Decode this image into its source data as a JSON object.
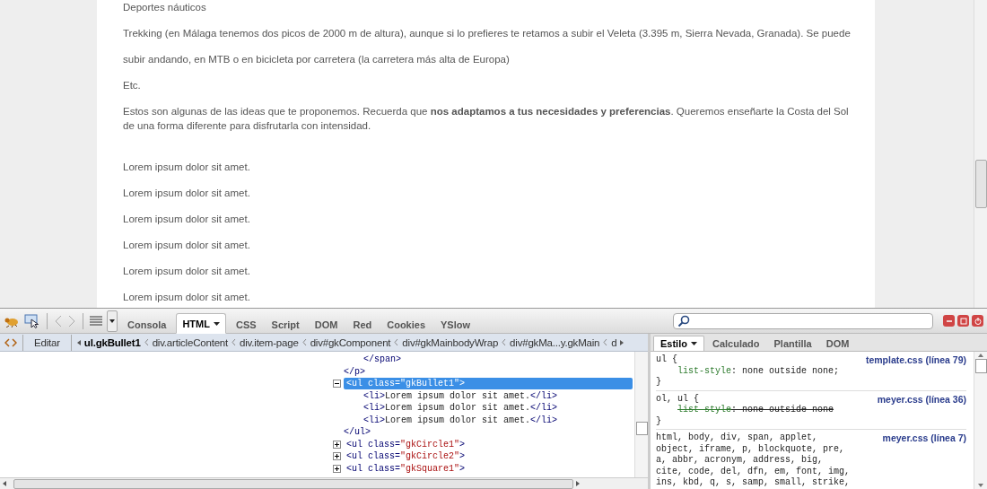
{
  "page": {
    "paragraphs": [
      {
        "kind": "p",
        "text": "Deportes náuticos"
      },
      {
        "kind": "p",
        "text": "Trekking (en Málaga tenemos dos picos de 2000 m de altura), aunque si lo prefieres te retamos a subir el Veleta (3.395 m, Sierra Nevada, Granada). Se puede"
      },
      {
        "kind": "p",
        "text": "subir andando, en MTB o en bicicleta por carretera (la carretera más alta de Europa)"
      },
      {
        "kind": "p",
        "text": "Etc."
      },
      {
        "kind": "p",
        "text": "Estos son algunas de las ideas que te proponemos. Recuerda que **nos adaptamos a tus necesidades y preferencias**. Queremos enseñarte la Costa del Sol de una forma diferente para disfrutarla con intensidad."
      },
      {
        "kind": "li",
        "text": "Lorem ipsum dolor sit amet."
      },
      {
        "kind": "li",
        "text": "Lorem ipsum dolor sit amet."
      },
      {
        "kind": "li",
        "text": "Lorem ipsum dolor sit amet."
      },
      {
        "kind": "li",
        "text": "Lorem ipsum dolor sit amet."
      },
      {
        "kind": "li",
        "text": "Lorem ipsum dolor sit amet."
      },
      {
        "kind": "li",
        "text": "Lorem ipsum dolor sit amet."
      }
    ]
  },
  "devtools": {
    "tabs": [
      {
        "label": "Consola",
        "selected": false,
        "dropdown": false
      },
      {
        "label": "HTML",
        "selected": true,
        "dropdown": true
      },
      {
        "label": "CSS",
        "selected": false,
        "dropdown": false
      },
      {
        "label": "Script",
        "selected": false,
        "dropdown": false
      },
      {
        "label": "DOM",
        "selected": false,
        "dropdown": false
      },
      {
        "label": "Red",
        "selected": false,
        "dropdown": false
      },
      {
        "label": "Cookies",
        "selected": false,
        "dropdown": false
      },
      {
        "label": "YSlow",
        "selected": false,
        "dropdown": false
      }
    ],
    "edit_button": "Editar",
    "breadcrumb": [
      {
        "label": "ul.gkBullet1",
        "selected": true
      },
      {
        "label": "div.articleContent",
        "selected": false
      },
      {
        "label": "div.item-page",
        "selected": false
      },
      {
        "label": "div#gkComponent",
        "selected": false
      },
      {
        "label": "div#gkMainbodyWrap",
        "selected": false
      },
      {
        "label": "div#gkMa...y.gkMain",
        "selected": false
      },
      {
        "label": "d",
        "selected": false
      }
    ],
    "html_tree": [
      {
        "kind": "partial",
        "children": [
          {
            "kind": "close",
            "text": "</span>"
          }
        ],
        "close": "</p>"
      },
      {
        "kind": "element",
        "tag_open": "<ul",
        "attr": " class=",
        "value": "\"gkBullet1\"",
        "tag_end": ">",
        "expanded": true,
        "selected": true,
        "children": [
          {
            "kind": "leaf",
            "open": "<li>",
            "text": "Lorem ipsum dolor sit amet.",
            "close": "</li>"
          },
          {
            "kind": "leaf",
            "open": "<li>",
            "text": "Lorem ipsum dolor sit amet.",
            "close": "</li>"
          },
          {
            "kind": "leaf",
            "open": "<li>",
            "text": "Lorem ipsum dolor sit amet.",
            "close": "</li>"
          }
        ],
        "close": "</ul>"
      },
      {
        "kind": "element",
        "tag_open": "<ul",
        "attr": " class=",
        "value": "\"gkCircle1\"",
        "tag_end": ">",
        "expanded": false,
        "selected": false
      },
      {
        "kind": "element",
        "tag_open": "<ul",
        "attr": " class=",
        "value": "\"gkCircle2\"",
        "tag_end": ">",
        "expanded": false,
        "selected": false
      },
      {
        "kind": "element",
        "tag_open": "<ul",
        "attr": " class=",
        "value": "\"gkSquare1\"",
        "tag_end": ">",
        "expanded": false,
        "selected": false
      }
    ],
    "side_tabs": [
      {
        "label": "Estilo",
        "selected": true,
        "dropdown": true
      },
      {
        "label": "Calculado",
        "selected": false,
        "dropdown": false
      },
      {
        "label": "Plantilla",
        "selected": false,
        "dropdown": false
      },
      {
        "label": "DOM",
        "selected": false,
        "dropdown": false
      }
    ],
    "rules": [
      {
        "selector": "ul {",
        "source": "template.css (línea 79)",
        "properties": [
          {
            "name": "list-style",
            "value": ": none outside none;",
            "overridden": false
          }
        ],
        "close": "}"
      },
      {
        "selector": "ol, ul {",
        "source": "meyer.css (línea 36)",
        "properties": [
          {
            "name": "list-style",
            "value": ": none outside none",
            "overridden": true
          }
        ],
        "close": "}"
      },
      {
        "selector": "html, body, div, span, applet,\nobject, iframe, p, blockquote, pre,\na, abbr, acronym, address, big,\ncite, code, del, dfn, em, font, img,\nins, kbd, q, s, samp, small, strike,",
        "source": "meyer.css (línea 7)"
      }
    ]
  }
}
